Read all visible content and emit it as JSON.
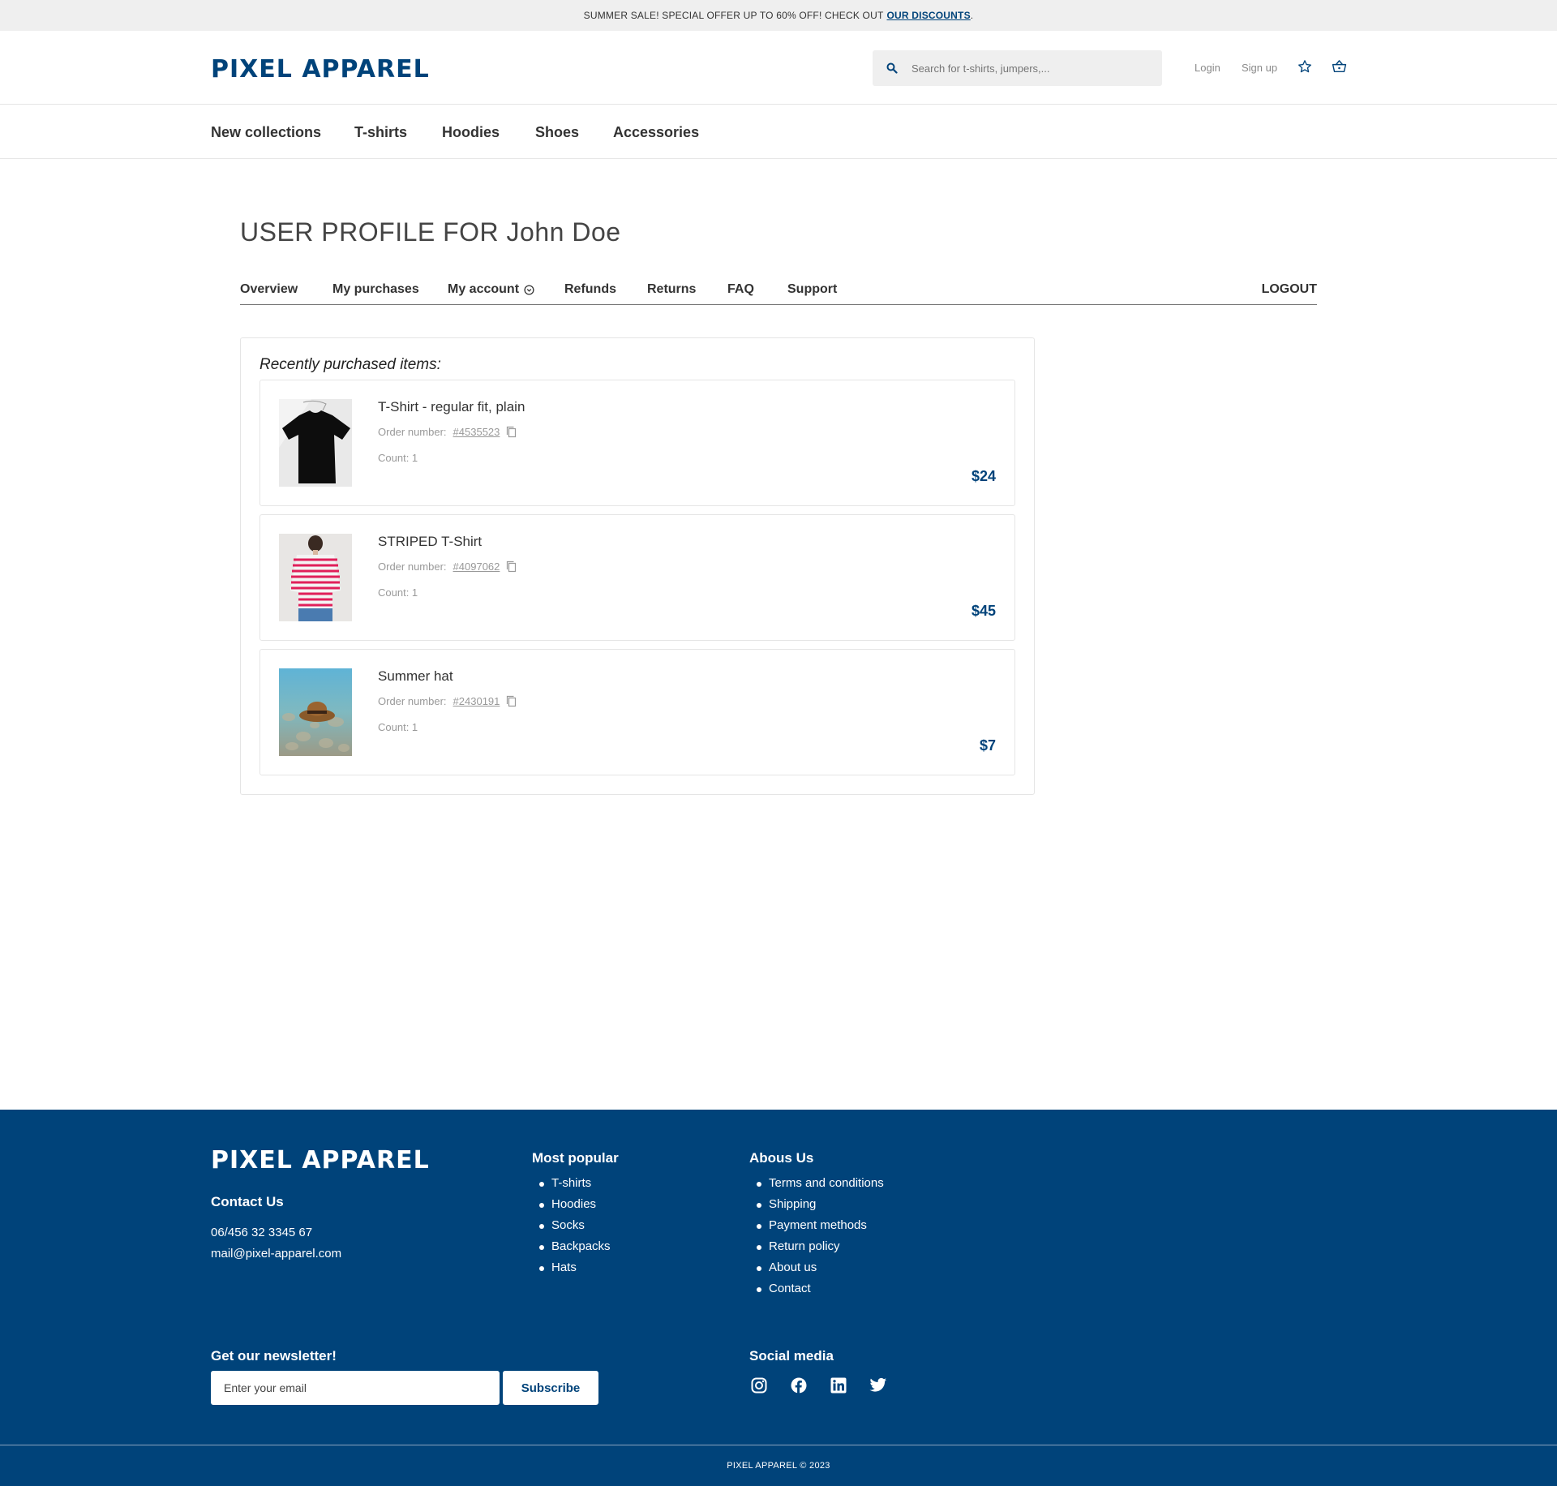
{
  "promo": {
    "text": "SUMMER SALE! SPECIAL OFFER UP TO 60% OFF! CHECK OUT",
    "link": "OUR DISCOUNTS",
    "end": "."
  },
  "header": {
    "logo": "PIXEL APPAREL",
    "search_placeholder": "Search for t-shirts, jumpers,...",
    "login": "Login",
    "signup": "Sign up"
  },
  "categories": [
    "New collections",
    "T-shirts",
    "Hoodies",
    "Shoes",
    "Accessories"
  ],
  "profile": {
    "title": "USER PROFILE FOR John Doe",
    "tabs": [
      "Overview",
      "My purchases",
      "My account",
      "Refunds",
      "Returns",
      "FAQ",
      "Support"
    ],
    "logout": "LOGOUT",
    "recent_title": "Recently purchased items:",
    "order_label": "Order number:",
    "items": [
      {
        "name": "T-Shirt - regular fit, plain",
        "order": "#4535523",
        "count": "Count: 1",
        "price": "$24"
      },
      {
        "name": "STRIPED T-Shirt",
        "order": "#4097062",
        "count": "Count: 1",
        "price": "$45"
      },
      {
        "name": "Summer hat",
        "order": "#2430191",
        "count": "Count: 1",
        "price": "$7"
      }
    ]
  },
  "footer": {
    "logo": "PIXEL APPAREL",
    "contact_heading": "Contact Us",
    "phone": "06/456 32 3345 67",
    "email": "mail@pixel-apparel.com",
    "popular_heading": "Most popular",
    "popular": [
      "T-shirts",
      "Hoodies",
      "Socks",
      "Backpacks",
      "Hats"
    ],
    "about_heading": "Abous Us",
    "about": [
      "Terms and conditions",
      "Shipping",
      "Payment methods",
      "Return policy",
      "About us",
      "Contact"
    ],
    "newsletter_heading": "Get our newsletter!",
    "newsletter_placeholder": "Enter your email",
    "subscribe": "Subscribe",
    "social_heading": "Social media",
    "copyright": "PIXEL APPAREL © 2023"
  },
  "colors": {
    "brand": "#00437a",
    "promo_bg": "#efefef",
    "footer_bg": "#00437a"
  }
}
